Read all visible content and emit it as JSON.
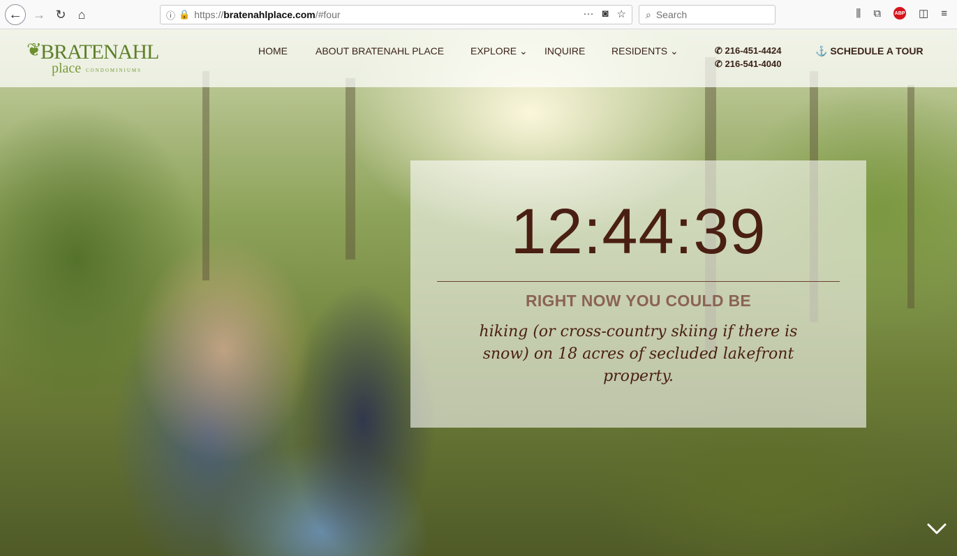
{
  "browser": {
    "url_prefix": "https://",
    "url_host": "bratenahlplace.com",
    "url_path": "/#four",
    "search_placeholder": "Search",
    "abp_label": "ABP"
  },
  "site": {
    "logo_main": "BRATENAHL",
    "logo_sub": "place",
    "logo_sub2": "CONDOMINIUMS",
    "nav": {
      "home": "HOME",
      "about": "ABOUT BRATENAHL PLACE",
      "explore": "EXPLORE ⌄",
      "inquire": "INQUIRE",
      "residents": "RESIDENTS ⌄"
    },
    "phone1": "216-451-4424",
    "phone2": "216-541-4040",
    "tour": "SCHEDULE A TOUR"
  },
  "hero": {
    "clock": "12:44:39",
    "subtitle": "RIGHT NOW YOU COULD BE",
    "activity_line1": "hiking (or cross-country skiing if there is",
    "activity_line2": "snow) on 18 acres of secluded lakefront",
    "activity_line3": "property."
  }
}
